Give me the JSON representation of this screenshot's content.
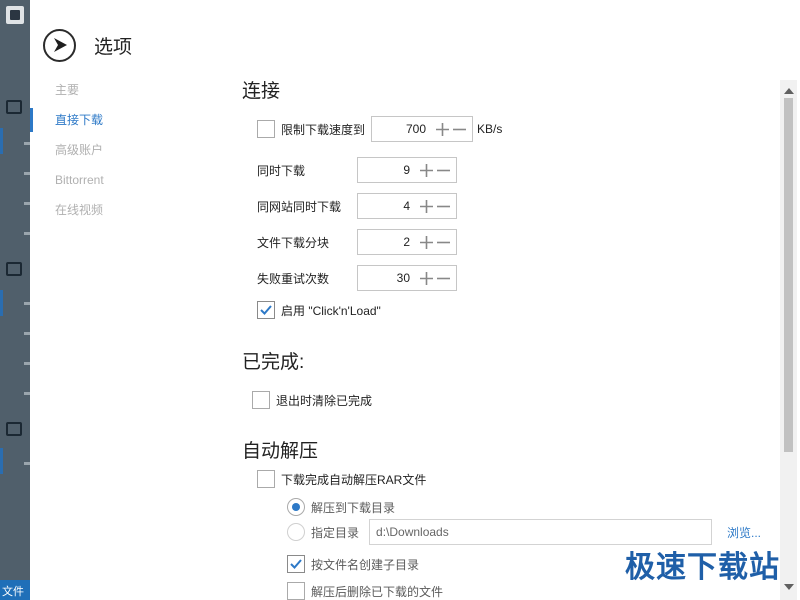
{
  "dialog": {
    "title": "选项"
  },
  "nav": {
    "items": [
      {
        "label": "主要",
        "active": false
      },
      {
        "label": "直接下载",
        "active": true
      },
      {
        "label": "高级账户",
        "active": false
      },
      {
        "label": "Bittorrent",
        "active": false
      },
      {
        "label": "在线视频",
        "active": false
      }
    ]
  },
  "connection": {
    "title": "连接",
    "limit_speed": {
      "label": "限制下载速度到",
      "checked": false,
      "value": "700",
      "unit": "KB/s"
    },
    "simultaneous_downloads": {
      "label": "同时下载",
      "value": "9"
    },
    "per_site_downloads": {
      "label": "同网站同时下载",
      "value": "4"
    },
    "file_chunks": {
      "label": "文件下载分块",
      "value": "2"
    },
    "retry_count": {
      "label": "失败重试次数",
      "value": "30"
    },
    "clicknload": {
      "label": "启用 \"Click'n'Load\"",
      "checked": true
    }
  },
  "completed": {
    "title": "已完成:",
    "clear_on_exit": {
      "label": "退出时清除已完成",
      "checked": false
    }
  },
  "auto_extract": {
    "title": "自动解压",
    "extract_rar": {
      "label": "下载完成自动解压RAR文件",
      "checked": false
    },
    "extract_to_download_dir": {
      "label": "解压到下载目录",
      "selected": true
    },
    "specify_dir": {
      "label": "指定目录",
      "selected": false,
      "path": "d:\\Downloads",
      "browse_label": "浏览..."
    },
    "create_subfolder": {
      "label": "按文件名创建子目录",
      "checked": true
    },
    "delete_after_extract": {
      "label": "解压后删除已下载的文件",
      "checked": false
    }
  },
  "background": {
    "footer_text": "文件"
  },
  "watermark": {
    "text": "极速下载站"
  },
  "colors": {
    "accent": "#2d79c7",
    "text": "#222222",
    "muted": "#b0b0b0"
  }
}
